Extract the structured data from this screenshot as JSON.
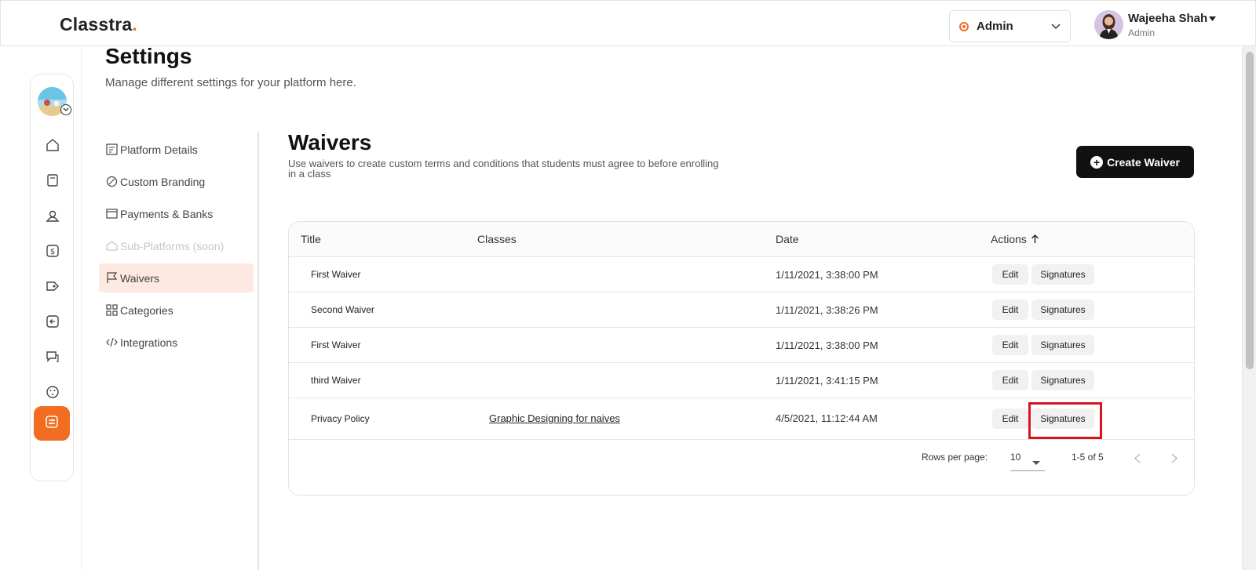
{
  "header": {
    "logo_text": "Classtra",
    "role_select": "Admin",
    "user_name": "Wajeeha Shah",
    "user_role": "Admin"
  },
  "rail": {
    "items": [
      "home-icon",
      "book-icon",
      "user-icon",
      "dollar-icon",
      "tag-icon",
      "back-arrow-icon",
      "chat-icon",
      "palette-icon",
      "settings-sliders-icon"
    ],
    "active_color": "#f26d21"
  },
  "page": {
    "title": "Settings",
    "subtitle": "Manage different settings for your platform here."
  },
  "settings_nav": [
    {
      "label": "Platform Details",
      "icon": "details-icon"
    },
    {
      "label": "Custom Branding",
      "icon": "palette-icon"
    },
    {
      "label": "Payments & Banks",
      "icon": "card-icon"
    },
    {
      "label": "Sub-Platforms (soon)",
      "icon": "home-icon"
    },
    {
      "label": "Waivers",
      "icon": "flag-icon"
    },
    {
      "label": "Categories",
      "icon": "grid-icon"
    },
    {
      "label": "Integrations",
      "icon": "code-icon"
    }
  ],
  "waivers": {
    "title": "Waivers",
    "description": "Use waivers to create custom terms and conditions that students must agree to before enrolling in a class",
    "create_button": "Create Waiver",
    "columns": [
      "Title",
      "Classes",
      "Date",
      "Actions"
    ],
    "rows": [
      {
        "title": "First Waiver",
        "classes": "",
        "date": "1/11/2021, 3:38:00 PM",
        "edit": "Edit",
        "signatures": "Signatures"
      },
      {
        "title": "Second Waiver",
        "classes": "",
        "date": "1/11/2021, 3:38:26 PM",
        "edit": "Edit",
        "signatures": "Signatures"
      },
      {
        "title": "First Waiver",
        "classes": "",
        "date": "1/11/2021, 3:38:00 PM",
        "edit": "Edit",
        "signatures": "Signatures"
      },
      {
        "title": "third Waiver",
        "classes": "",
        "date": "1/11/2021, 3:41:15 PM",
        "edit": "Edit",
        "signatures": "Signatures"
      },
      {
        "title": "Privacy Policy",
        "classes": "Graphic Designing for naives",
        "date": "4/5/2021, 11:12:44 AM",
        "edit": "Edit",
        "signatures": "Signatures"
      }
    ],
    "pagination": {
      "rows_per_page_label": "Rows per page:",
      "rows_per_page": "10",
      "range": "1-5 of 5"
    }
  },
  "colors": {
    "accent": "#f26d21",
    "active_nav_bg": "#fde9e1",
    "highlight_box": "#d9121b"
  }
}
